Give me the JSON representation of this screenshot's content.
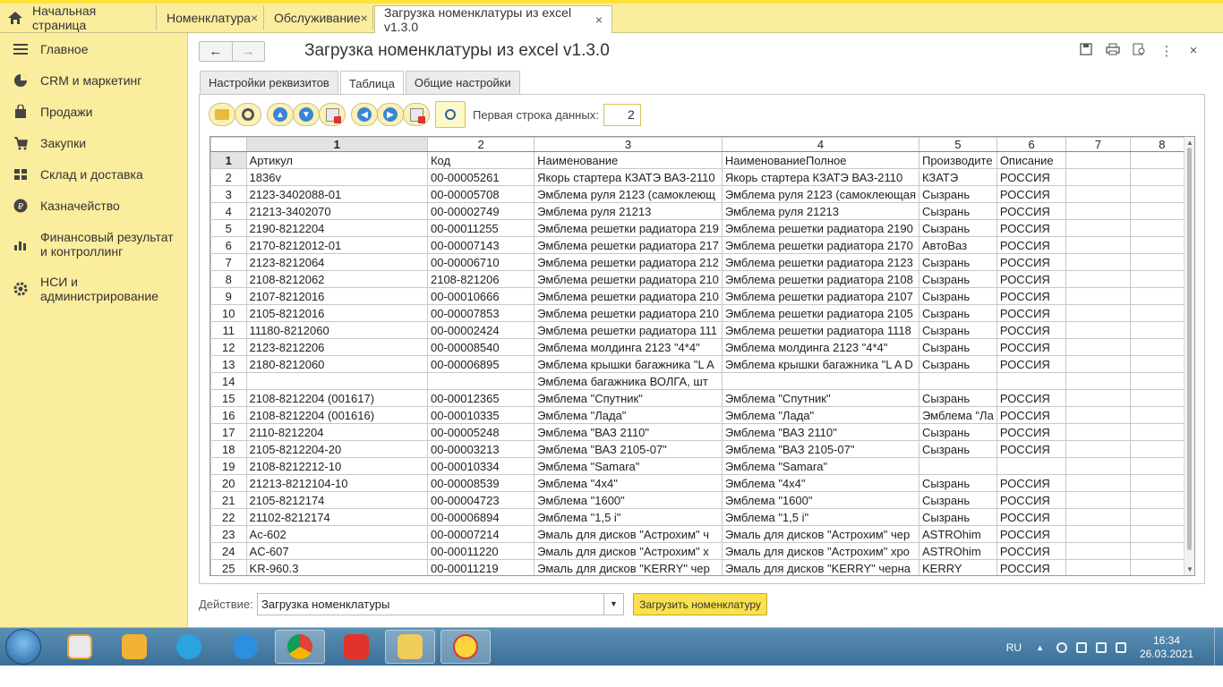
{
  "tabs": {
    "home": "Начальная страница",
    "items": [
      {
        "label": "Номенклатура",
        "close": "×"
      },
      {
        "label": "Обслуживание",
        "close": "×"
      },
      {
        "label": "Загрузка номенклатуры из excel v1.3.0",
        "close": "×"
      }
    ]
  },
  "sidebar": {
    "items": [
      {
        "label": "Главное",
        "icon": "menu-icon"
      },
      {
        "label": "CRM и маркетинг",
        "icon": "pie-chart-icon"
      },
      {
        "label": "Продажи",
        "icon": "bag-icon"
      },
      {
        "label": "Закупки",
        "icon": "cart-icon"
      },
      {
        "label": "Склад и доставка",
        "icon": "warehouse-icon"
      },
      {
        "label": "Казначейство",
        "icon": "ruble-coin-icon"
      },
      {
        "label": "Финансовый результат и контроллинг",
        "icon": "bar-chart-icon"
      },
      {
        "label": "НСИ и администрирование",
        "icon": "gear-icon"
      }
    ]
  },
  "form": {
    "back": "←",
    "forward": "→",
    "title": "Загрузка номенклатуры из excel v1.3.0",
    "tabs": [
      "Настройки реквизитов",
      "Таблица",
      "Общие настройки"
    ],
    "first_row_label": "Первая строка данных:",
    "first_row_value": "2",
    "action_label": "Действие:",
    "action_value": "Загрузка номенклатуры",
    "load_button": "Загрузить номенклатуру"
  },
  "grid": {
    "columns": [
      "1",
      "2",
      "3",
      "4",
      "5",
      "6",
      "7",
      "8"
    ],
    "header_row": {
      "n": "1",
      "cells": [
        "Артикул",
        "Код",
        "Наименование",
        "НаименованиеПолное",
        "Производите",
        "Описание",
        "",
        ""
      ]
    },
    "rows": [
      {
        "n": "2",
        "cells": [
          "1836v",
          "00-00005261",
          "Якорь стартера КЗАТЭ ВАЗ-2110",
          "Якорь стартера КЗАТЭ ВАЗ-2110",
          "КЗАТЭ",
          "РОССИЯ"
        ]
      },
      {
        "n": "3",
        "cells": [
          "2123-3402088-01",
          "00-00005708",
          "Эмблема руля 2123 (самоклеющ",
          "Эмблема руля 2123 (самоклеющая",
          "Сызрань",
          "РОССИЯ"
        ]
      },
      {
        "n": "4",
        "cells": [
          "21213-3402070",
          "00-00002749",
          "Эмблема руля 21213",
          "Эмблема руля 21213",
          "Сызрань",
          "РОССИЯ"
        ]
      },
      {
        "n": "5",
        "cells": [
          "2190-8212204",
          "00-00011255",
          "Эмблема решетки радиатора 219",
          "Эмблема решетки радиатора 2190",
          "Сызрань",
          "РОССИЯ"
        ]
      },
      {
        "n": "6",
        "cells": [
          "2170-8212012-01",
          "00-00007143",
          "Эмблема решетки радиатора 217",
          "Эмблема решетки радиатора 2170",
          "АвтоВаз",
          "РОССИЯ"
        ]
      },
      {
        "n": "7",
        "cells": [
          "2123-8212064",
          "00-00006710",
          "Эмблема решетки радиатора 212",
          "Эмблема решетки радиатора 2123",
          "Сызрань",
          "РОССИЯ"
        ]
      },
      {
        "n": "8",
        "cells": [
          "2108-8212062",
          "2108-821206",
          "Эмблема решетки радиатора 210",
          "Эмблема решетки радиатора 2108",
          "Сызрань",
          "РОССИЯ"
        ]
      },
      {
        "n": "9",
        "cells": [
          "2107-8212016",
          "00-00010666",
          "Эмблема решетки радиатора 210",
          "Эмблема решетки радиатора 2107",
          "Сызрань",
          "РОССИЯ"
        ]
      },
      {
        "n": "10",
        "cells": [
          "2105-8212016",
          "00-00007853",
          "Эмблема решетки радиатора 210",
          "Эмблема решетки радиатора 2105",
          "Сызрань",
          "РОССИЯ"
        ]
      },
      {
        "n": "11",
        "cells": [
          "11180-8212060",
          "00-00002424",
          "Эмблема решетки радиатора 111",
          "Эмблема решетки радиатора 1118",
          "Сызрань",
          "РОССИЯ"
        ]
      },
      {
        "n": "12",
        "cells": [
          "2123-8212206",
          "00-00008540",
          "Эмблема молдинга 2123 \"4*4\"",
          "Эмблема молдинга 2123 \"4*4\"",
          "Сызрань",
          "РОССИЯ"
        ]
      },
      {
        "n": "13",
        "cells": [
          "2180-8212060",
          "00-00006895",
          "Эмблема крышки багажника \"L A",
          "Эмблема крышки багажника \"L A D",
          "Сызрань",
          "РОССИЯ"
        ]
      },
      {
        "n": "14",
        "cells": [
          "",
          "",
          "Эмблема багажника ВОЛГА, шт",
          "",
          "",
          ""
        ]
      },
      {
        "n": "15",
        "cells": [
          "2108-8212204 (001617)",
          "00-00012365",
          "Эмблема \"Спутник\"",
          "Эмблема \"Спутник\"",
          "Сызрань",
          "РОССИЯ"
        ]
      },
      {
        "n": "16",
        "cells": [
          "2108-8212204 (001616)",
          "00-00010335",
          "Эмблема \"Лада\"",
          "Эмблема \"Лада\"",
          "Эмблема \"Ла",
          "РОССИЯ"
        ]
      },
      {
        "n": "17",
        "cells": [
          "2110-8212204",
          "00-00005248",
          "Эмблема \"ВАЗ 2110\"",
          "Эмблема \"ВАЗ 2110\"",
          "Сызрань",
          "РОССИЯ"
        ]
      },
      {
        "n": "18",
        "cells": [
          "2105-8212204-20",
          "00-00003213",
          "Эмблема \"ВАЗ 2105-07\"",
          "Эмблема \"ВАЗ 2105-07\"",
          "Сызрань",
          "РОССИЯ"
        ]
      },
      {
        "n": "19",
        "cells": [
          "2108-8212212-10",
          "00-00010334",
          "Эмблема \"Samara\"",
          "Эмблема \"Samara\"",
          "",
          ""
        ]
      },
      {
        "n": "20",
        "cells": [
          "21213-8212104-10",
          "00-00008539",
          "Эмблема \"4x4\"",
          "Эмблема \"4x4\"",
          "Сызрань",
          "РОССИЯ"
        ]
      },
      {
        "n": "21",
        "cells": [
          "2105-8212174",
          "00-00004723",
          "Эмблема \"1600\"",
          "Эмблема \"1600\"",
          "Сызрань",
          "РОССИЯ"
        ]
      },
      {
        "n": "22",
        "cells": [
          "21102-8212174",
          "00-00006894",
          "Эмблема \"1,5 i\"",
          "Эмблема \"1,5 i\"",
          "Сызрань",
          "РОССИЯ"
        ]
      },
      {
        "n": "23",
        "cells": [
          "Ac-602",
          "00-00007214",
          "Эмаль для дисков \"Астрохим\" ч",
          "Эмаль для дисков \"Астрохим\" чер",
          "ASTROhim",
          "РОССИЯ"
        ]
      },
      {
        "n": "24",
        "cells": [
          "AC-607",
          "00-00011220",
          "Эмаль для дисков \"Астрохим\" х",
          "Эмаль для дисков \"Астрохим\" хро",
          "ASTROhim",
          "РОССИЯ"
        ]
      },
      {
        "n": "25",
        "cells": [
          "KR-960.3",
          "00-00011219",
          "Эмаль для дисков \"KERRY\" чер",
          "Эмаль для дисков \"KERRY\" черна",
          "KERRY",
          "РОССИЯ"
        ]
      }
    ]
  },
  "taskbar": {
    "lang": "RU",
    "time": "16:34",
    "date": "26.03.2021"
  },
  "colors": {
    "sidebar": "#fbed9e",
    "accent": "#fbe14d",
    "taskbar": "#3c6f97"
  }
}
